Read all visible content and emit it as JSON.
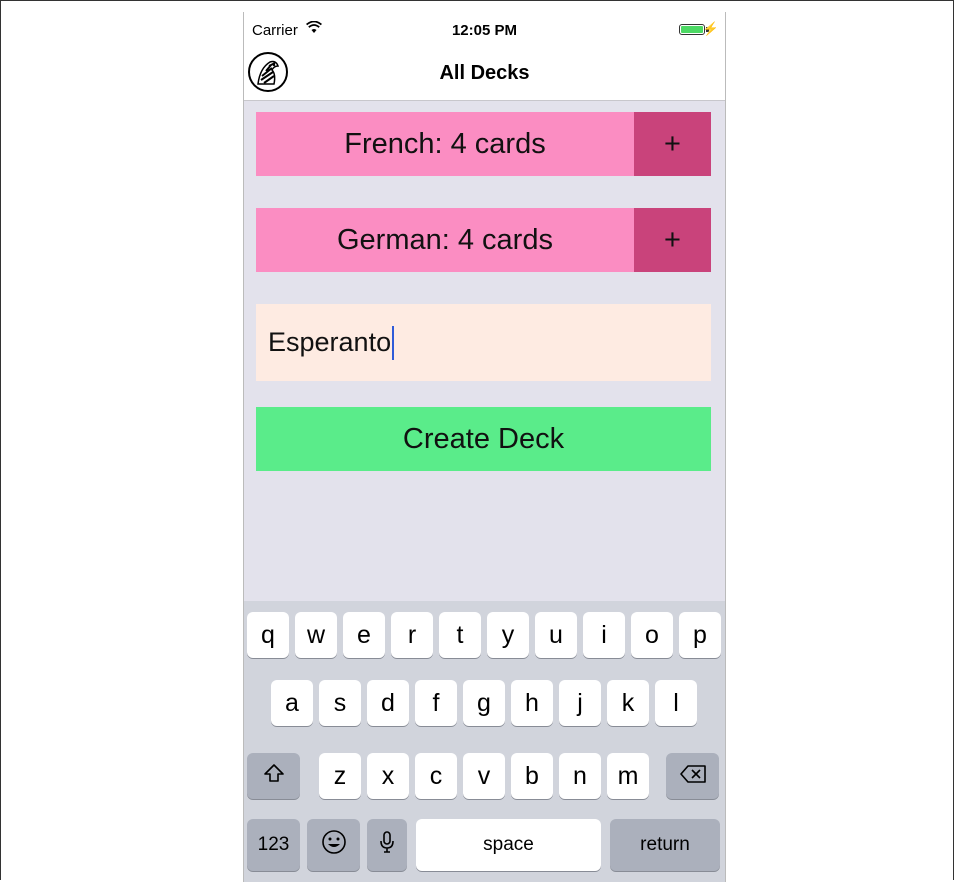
{
  "status_bar": {
    "carrier": "Carrier",
    "wifi_icon": "wifi-icon",
    "time": "12:05 PM",
    "battery_icon": "battery-charging-icon"
  },
  "nav": {
    "title": "All Decks",
    "logo_icon": "zebra-logo-icon"
  },
  "decks": [
    {
      "label": "French: 4 cards",
      "add": "+"
    },
    {
      "label": "German: 4 cards",
      "add": "+"
    }
  ],
  "new_deck_input": {
    "value": "Esperanto"
  },
  "create_button": {
    "label": "Create Deck"
  },
  "colors": {
    "deck": "#fb8dc2",
    "deck_add": "#c9437b",
    "input_bg": "#feebe2",
    "create": "#5aec8a",
    "background": "#e3e2ec"
  },
  "keyboard": {
    "row1": [
      "q",
      "w",
      "e",
      "r",
      "t",
      "y",
      "u",
      "i",
      "o",
      "p"
    ],
    "row2": [
      "a",
      "s",
      "d",
      "f",
      "g",
      "h",
      "j",
      "k",
      "l"
    ],
    "row3": [
      "z",
      "x",
      "c",
      "v",
      "b",
      "n",
      "m"
    ],
    "shift_icon": "shift-icon",
    "delete_icon": "backspace-icon",
    "numbers": "123",
    "emoji_icon": "emoji-icon",
    "mic_icon": "microphone-icon",
    "space": "space",
    "return": "return"
  }
}
